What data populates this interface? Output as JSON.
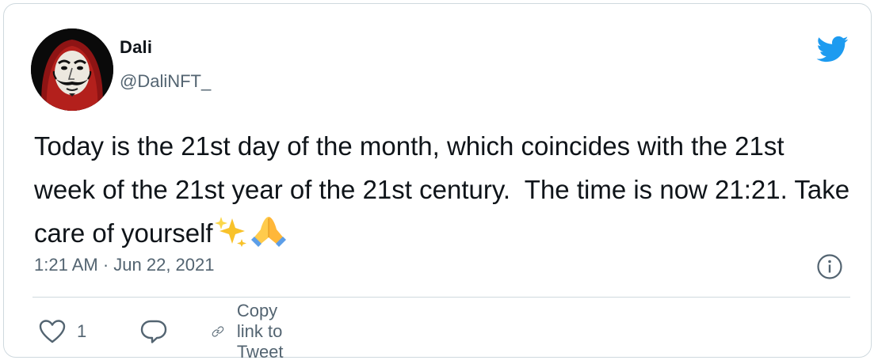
{
  "tweet": {
    "author": {
      "name": "Dali",
      "handle": "@DaliNFT_",
      "avatar_icon": "masked-face-avatar"
    },
    "platform_icon": "twitter-bird-icon",
    "text": "Today is the 21st day of the month, which coincides with the 21st week of the 21st year of the 21st century.  The time is now 21:21. Take care of yourself",
    "emojis": [
      "sparkles-emoji",
      "folded-hands-emoji"
    ],
    "timestamp": "1:21 AM · Jun 22, 2021",
    "info_icon": "info-icon",
    "actions": {
      "like_count": "1",
      "copy_link_label": "Copy link to Tweet"
    },
    "colors": {
      "brand_blue": "#1d9bf0",
      "text_primary": "#0f1419",
      "text_secondary": "#536471",
      "border": "#cfd9de"
    }
  }
}
